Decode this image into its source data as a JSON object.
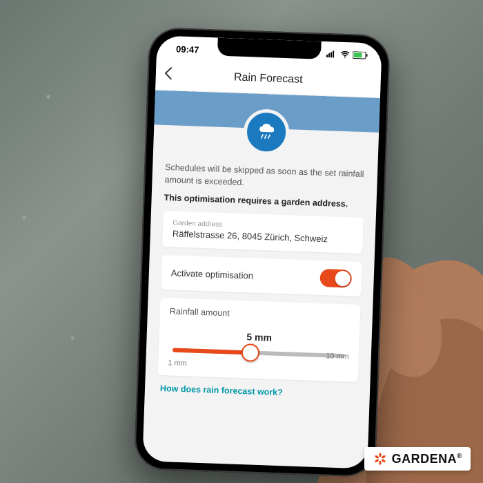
{
  "status": {
    "time": "09:47"
  },
  "header": {
    "title": "Rain Forecast"
  },
  "content": {
    "description": "Schedules will be skipped as soon as the set rainfall amount is exceeded.",
    "requirement": "This optimisation requires a garden address.",
    "address_label": "Garden address",
    "address_value": "Räffelstrasse 26, 8045 Zürich, Schweiz",
    "activate_label": "Activate optimisation",
    "rainfall_label": "Rainfall amount",
    "rainfall_value": "5 mm",
    "rainfall_min": "1 mm",
    "rainfall_max": "10 mm",
    "help_link": "How does rain forecast work?"
  },
  "brand": {
    "name": "GARDENA"
  },
  "colors": {
    "accent": "#e8491b",
    "band": "#6b9dc9",
    "link": "#0097a7"
  }
}
